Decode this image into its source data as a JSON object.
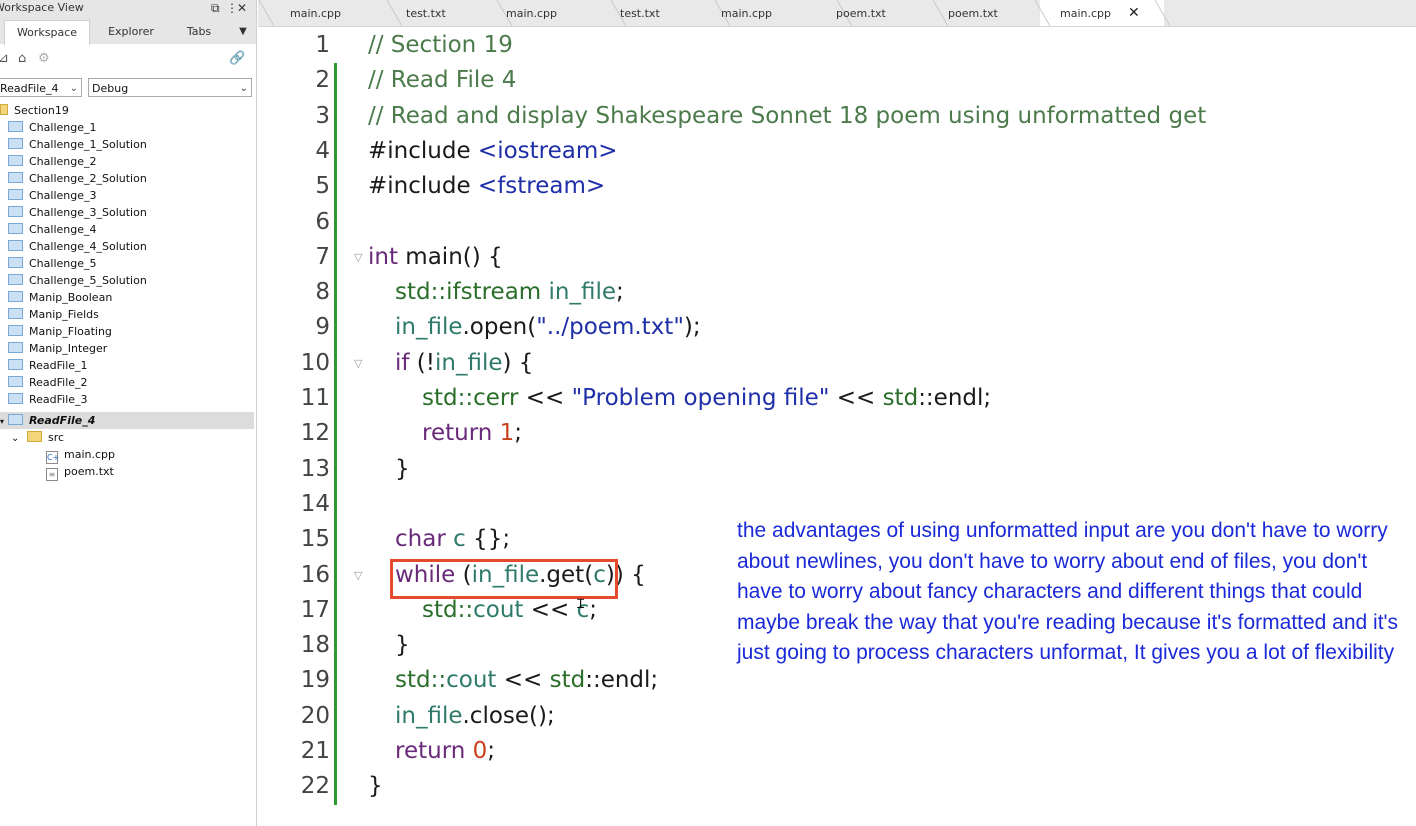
{
  "sidebar": {
    "title": "Workspace View",
    "tabs": [
      {
        "label": "Workspace"
      },
      {
        "label": "Explorer"
      },
      {
        "label": "Tabs"
      }
    ],
    "project_select": "ReadFile_4",
    "config_select": "Debug",
    "tree": {
      "root": "Section19",
      "items": [
        "Challenge_1",
        "Challenge_1_Solution",
        "Challenge_2",
        "Challenge_2_Solution",
        "Challenge_3",
        "Challenge_3_Solution",
        "Challenge_4",
        "Challenge_4_Solution",
        "Challenge_5",
        "Challenge_5_Solution",
        "Manip_Boolean",
        "Manip_Fields",
        "Manip_Floating",
        "Manip_Integer",
        "ReadFile_1",
        "ReadFile_2",
        "ReadFile_3"
      ],
      "selected": "ReadFile_4",
      "src_folder": "src",
      "files": [
        "main.cpp",
        "poem.txt"
      ]
    }
  },
  "editor": {
    "tabs": [
      {
        "label": "main.cpp"
      },
      {
        "label": "test.txt"
      },
      {
        "label": "main.cpp"
      },
      {
        "label": "test.txt"
      },
      {
        "label": "main.cpp"
      },
      {
        "label": "poem.txt"
      },
      {
        "label": "poem.txt"
      },
      {
        "label": "main.cpp",
        "active": true
      }
    ],
    "line_numbers": [
      "1",
      "2",
      "3",
      "4",
      "5",
      "6",
      "7",
      "8",
      "9",
      "10",
      "11",
      "12",
      "13",
      "14",
      "15",
      "16",
      "17",
      "18",
      "19",
      "20",
      "21",
      "22"
    ],
    "code": {
      "l1": "// Section 19",
      "l2": "// Read File 4",
      "l3": "// Read and display Shakespeare Sonnet 18 poem using unformatted get",
      "l4_a": "#include ",
      "l4_b": "<iostream>",
      "l5_a": "#include ",
      "l5_b": "<fstream>",
      "l7_a": "int",
      "l7_b": " main() {",
      "l8_a": "std",
      "l8_b": "::",
      "l8_c": "ifstream",
      "l8_d": " ",
      "l8_e": "in_file",
      "l8_f": ";",
      "l9_a": "in_file",
      "l9_b": ".open(",
      "l9_c": "\"../poem.txt\"",
      "l9_d": ");",
      "l10_a": "if",
      "l10_b": " (!",
      "l10_c": "in_file",
      "l10_d": ") {",
      "l11_a": "std",
      "l11_b": "::",
      "l11_c": "cerr",
      "l11_d": " << ",
      "l11_e": "\"Problem opening file\"",
      "l11_f": " << ",
      "l11_g": "std",
      "l11_h": "::endl;",
      "l12_a": "return",
      "l12_b": " ",
      "l12_c": "1",
      "l12_d": ";",
      "l13": "}",
      "l15_a": "char",
      "l15_b": " ",
      "l15_c": "c",
      "l15_d": " {};",
      "l16_a": "while",
      "l16_b": " (",
      "l16_c": "in_file",
      "l16_d": ".get(",
      "l16_e": "c",
      "l16_f": ")) {",
      "l17_a": "std",
      "l17_b": "::",
      "l17_c": "cout",
      "l17_d": " << ",
      "l17_e": "c",
      "l17_f": ";",
      "l18": "}",
      "l19_a": "std",
      "l19_b": "::",
      "l19_c": "cout",
      "l19_d": " << ",
      "l19_e": "std",
      "l19_f": "::endl;",
      "l20_a": "in_file",
      "l20_b": ".close();",
      "l21_a": "return",
      "l21_b": " ",
      "l21_c": "0",
      "l21_d": ";",
      "l22": "}"
    }
  },
  "annotation": {
    "text": "the advantages of using unformatted input are you don't have to worry about newlines, you don't have to worry about end of files, you don't have to worry about fancy characters and different things that could maybe break the way that you're reading because it's formatted and it's just going to process characters unformat, It gives you a lot of flexibility",
    "color": "#1a2ad8"
  },
  "colors": {
    "highlight_box": "#e34b2c",
    "change_bar": "#2e9a2e"
  }
}
